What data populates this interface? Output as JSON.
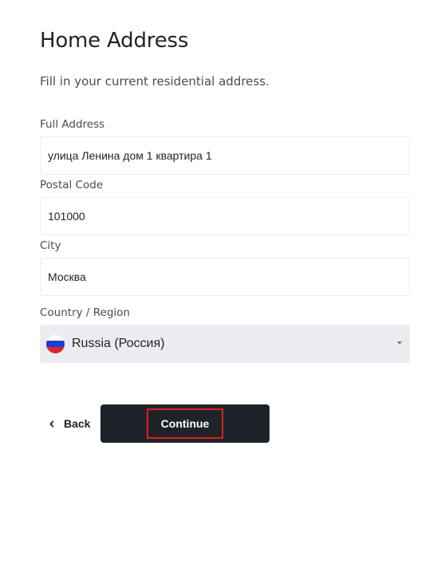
{
  "page": {
    "title": "Home Address",
    "subtitle": "Fill in your current residential address."
  },
  "form": {
    "full_address": {
      "label": "Full Address",
      "value": "улица Ленина дом 1 квартира 1"
    },
    "postal_code": {
      "label": "Postal Code",
      "value": "101000"
    },
    "city": {
      "label": "City",
      "value": "Москва"
    },
    "country": {
      "label": "Country / Region",
      "value": "Russia (Россия)",
      "flag_icon": "russia-flag-icon"
    }
  },
  "actions": {
    "back_label": "Back",
    "back_icon": "chevron-left-icon",
    "continue_label": "Continue"
  },
  "colors": {
    "primary_dark": "#1e2329",
    "input_border": "#eaecef",
    "select_bg": "#eaecef",
    "highlight_box": "#e01e1e"
  }
}
